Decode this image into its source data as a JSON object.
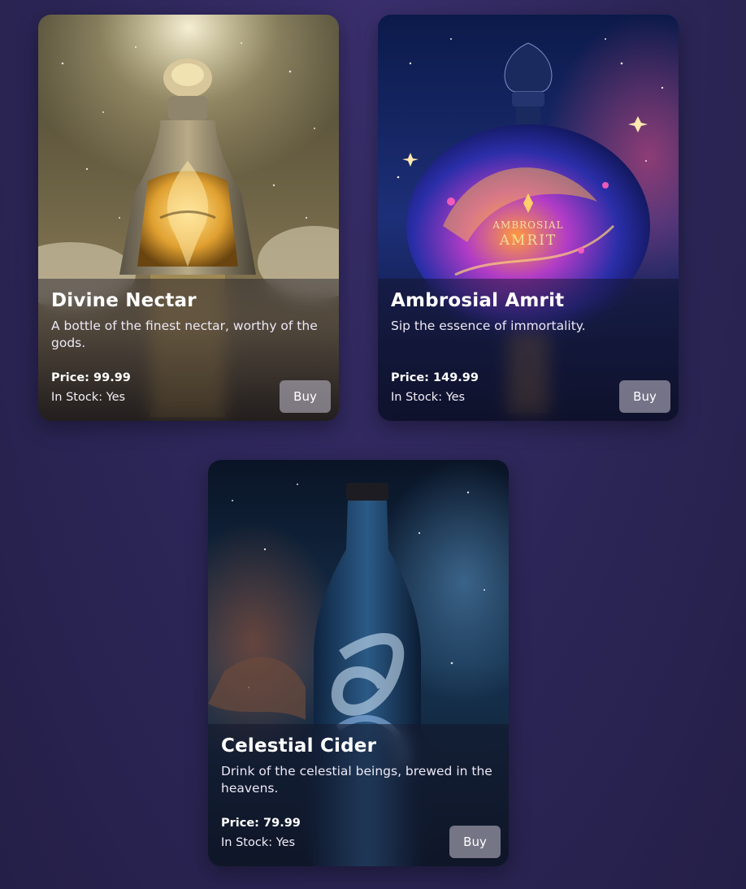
{
  "products": [
    {
      "title": "Divine Nectar",
      "description": "A bottle of the finest nectar, worthy of the gods.",
      "price_label": "Price: 99.99",
      "stock_label": "In Stock: Yes",
      "buy_label": "Buy",
      "bottle_label_lines": []
    },
    {
      "title": "Ambrosial Amrit",
      "description": "Sip the essence of immortality.",
      "price_label": "Price: 149.99",
      "stock_label": "In Stock: Yes",
      "buy_label": "Buy",
      "bottle_label_lines": [
        "AMBROSIAL",
        "AMRIT"
      ]
    },
    {
      "title": "Celestial Cider",
      "description": "Drink of the celestial beings, brewed in the heavens.",
      "price_label": "Price: 79.99",
      "stock_label": "In Stock: Yes",
      "buy_label": "Buy",
      "bottle_label_lines": []
    }
  ],
  "colors": {
    "background": "#2c2658",
    "card_overlay": "#141223",
    "button": "#b9b4c3"
  }
}
